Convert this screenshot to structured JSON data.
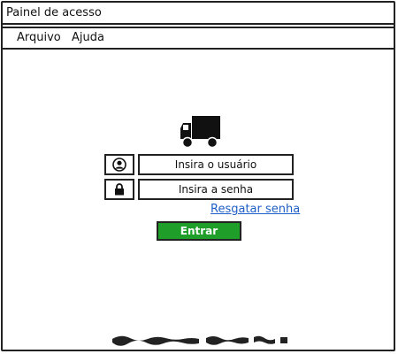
{
  "window": {
    "title": "Painel de acesso"
  },
  "menu": {
    "items": [
      "Arquivo",
      "Ajuda"
    ]
  },
  "login": {
    "logo_icon": "truck-icon",
    "username_placeholder": "Insira o usuário",
    "username_icon": "user-circle-icon",
    "password_placeholder": "Insira a senha",
    "password_icon": "lock-icon",
    "recover_link": "Resgatar senha",
    "submit_label": "Entrar"
  },
  "colors": {
    "accent": "#1f9e2a",
    "link": "#1f5fc7"
  }
}
